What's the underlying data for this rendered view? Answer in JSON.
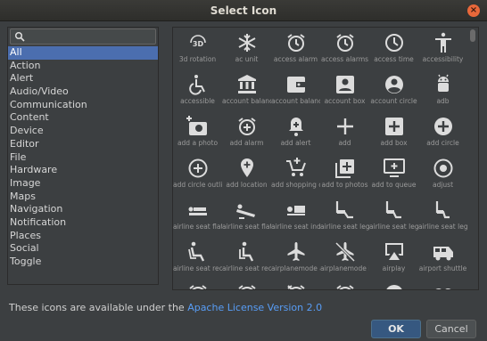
{
  "dialog": {
    "title": "Select Icon",
    "close_glyph": "×"
  },
  "search": {
    "value": "",
    "placeholder": ""
  },
  "categories": [
    {
      "label": "All",
      "selected": true
    },
    {
      "label": "Action"
    },
    {
      "label": "Alert"
    },
    {
      "label": "Audio/Video"
    },
    {
      "label": "Communication"
    },
    {
      "label": "Content"
    },
    {
      "label": "Device"
    },
    {
      "label": "Editor"
    },
    {
      "label": "File"
    },
    {
      "label": "Hardware"
    },
    {
      "label": "Image"
    },
    {
      "label": "Maps"
    },
    {
      "label": "Navigation"
    },
    {
      "label": "Notification"
    },
    {
      "label": "Places"
    },
    {
      "label": "Social"
    },
    {
      "label": "Toggle"
    }
  ],
  "icons": [
    {
      "label": "3d rotation",
      "icon": "3d-rotation-icon"
    },
    {
      "label": "ac unit",
      "icon": "ac-unit-icon"
    },
    {
      "label": "access alarm",
      "icon": "alarm-icon"
    },
    {
      "label": "access alarms",
      "icon": "alarms-icon"
    },
    {
      "label": "access time",
      "icon": "time-icon"
    },
    {
      "label": "accessibility",
      "icon": "accessibility-icon"
    },
    {
      "label": "accessible",
      "icon": "wheelchair-icon"
    },
    {
      "label": "account balanc",
      "icon": "bank-icon"
    },
    {
      "label": "account balanc",
      "icon": "wallet-icon"
    },
    {
      "label": "account box",
      "icon": "account-box-icon"
    },
    {
      "label": "account circle",
      "icon": "account-circle-icon"
    },
    {
      "label": "adb",
      "icon": "android-icon"
    },
    {
      "label": "add a photo",
      "icon": "add-photo-icon"
    },
    {
      "label": "add alarm",
      "icon": "add-alarm-icon"
    },
    {
      "label": "add alert",
      "icon": "add-alert-icon"
    },
    {
      "label": "add",
      "icon": "plus-icon"
    },
    {
      "label": "add box",
      "icon": "add-box-icon"
    },
    {
      "label": "add circle",
      "icon": "add-circle-icon"
    },
    {
      "label": "add circle outli",
      "icon": "add-circle-outline-icon"
    },
    {
      "label": "add location",
      "icon": "add-location-icon"
    },
    {
      "label": "add shopping c",
      "icon": "add-shopping-cart-icon"
    },
    {
      "label": "add to photos",
      "icon": "add-to-photos-icon"
    },
    {
      "label": "add to queue",
      "icon": "add-to-queue-icon"
    },
    {
      "label": "adjust",
      "icon": "adjust-icon"
    },
    {
      "label": "airline seat flat",
      "icon": "seat-flat-icon"
    },
    {
      "label": "airline seat flat",
      "icon": "seat-flat-angled-icon"
    },
    {
      "label": "airline seat ind",
      "icon": "seat-individual-icon"
    },
    {
      "label": "airline seat leg",
      "icon": "seat-legroom-extra-icon"
    },
    {
      "label": "airline seat leg",
      "icon": "seat-legroom-normal-icon"
    },
    {
      "label": "airline seat leg",
      "icon": "seat-legroom-reduced-icon"
    },
    {
      "label": "airline seat rec",
      "icon": "seat-recline-extra-icon"
    },
    {
      "label": "airline seat rec",
      "icon": "seat-recline-normal-icon"
    },
    {
      "label": "airplanemode a",
      "icon": "airplane-icon"
    },
    {
      "label": "airplanemode i",
      "icon": "airplane-off-icon"
    },
    {
      "label": "airplay",
      "icon": "airplay-icon"
    },
    {
      "label": "airport shuttle",
      "icon": "shuttle-icon"
    },
    {
      "label": "",
      "icon": "alarm-icon"
    },
    {
      "label": "",
      "icon": "alarm-icon"
    },
    {
      "label": "",
      "icon": "alarm-off-icon"
    },
    {
      "label": "",
      "icon": "alarm-on-icon"
    },
    {
      "label": "",
      "icon": "album-icon"
    },
    {
      "label": "",
      "icon": "all-inclusive-icon"
    }
  ],
  "footer": {
    "text": "These icons are available under the ",
    "link": "Apache License Version 2.0"
  },
  "buttons": {
    "ok": "OK",
    "cancel": "Cancel"
  },
  "colors": {
    "selection": "#4b6eaf",
    "link": "#589df6",
    "icon": "#dcdcdc"
  }
}
